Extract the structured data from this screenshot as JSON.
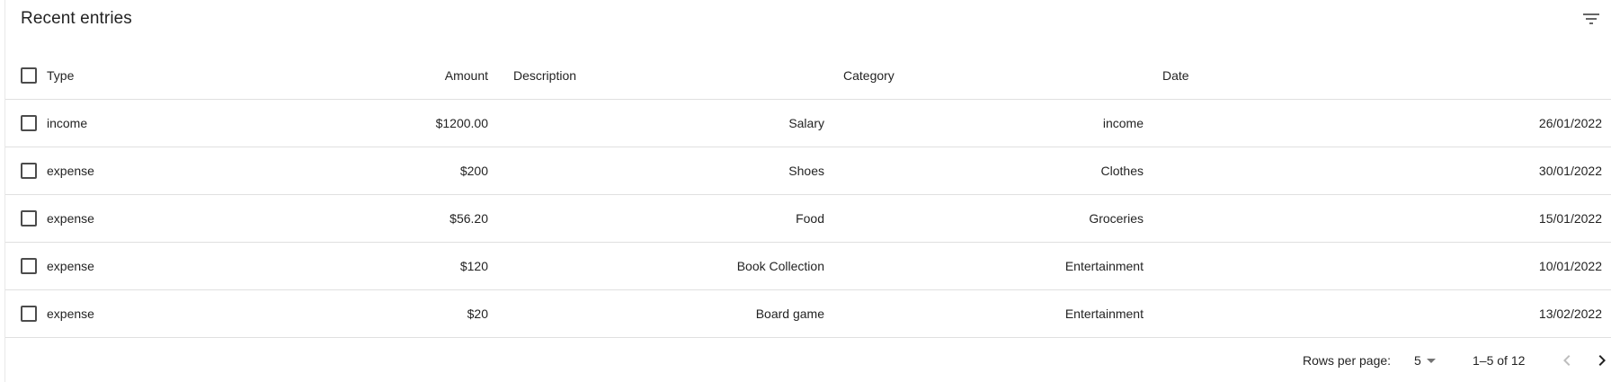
{
  "toolbar": {
    "title": "Recent entries",
    "filter_icon": "filter-list-icon"
  },
  "table": {
    "columns": [
      "Type",
      "Amount",
      "Description",
      "Category",
      "Date"
    ],
    "rows": [
      {
        "type": "income",
        "amount": "$1200.00",
        "description": "Salary",
        "category": "income",
        "date": "26/01/2022"
      },
      {
        "type": "expense",
        "amount": "$200",
        "description": "Shoes",
        "category": "Clothes",
        "date": "30/01/2022"
      },
      {
        "type": "expense",
        "amount": "$56.20",
        "description": "Food",
        "category": "Groceries",
        "date": "15/01/2022"
      },
      {
        "type": "expense",
        "amount": "$120",
        "description": "Book Collection",
        "category": "Entertainment",
        "date": "10/01/2022"
      },
      {
        "type": "expense",
        "amount": "$20",
        "description": "Board game",
        "category": "Entertainment",
        "date": "13/02/2022"
      }
    ]
  },
  "pagination": {
    "rows_per_page_label": "Rows per page:",
    "rows_per_page_value": "5",
    "range_label": "1–5 of 12",
    "prev_icon": "chevron-left-icon",
    "next_icon": "chevron-right-icon",
    "prev_disabled_color": "#bdbdbd",
    "next_color": "#212121"
  }
}
